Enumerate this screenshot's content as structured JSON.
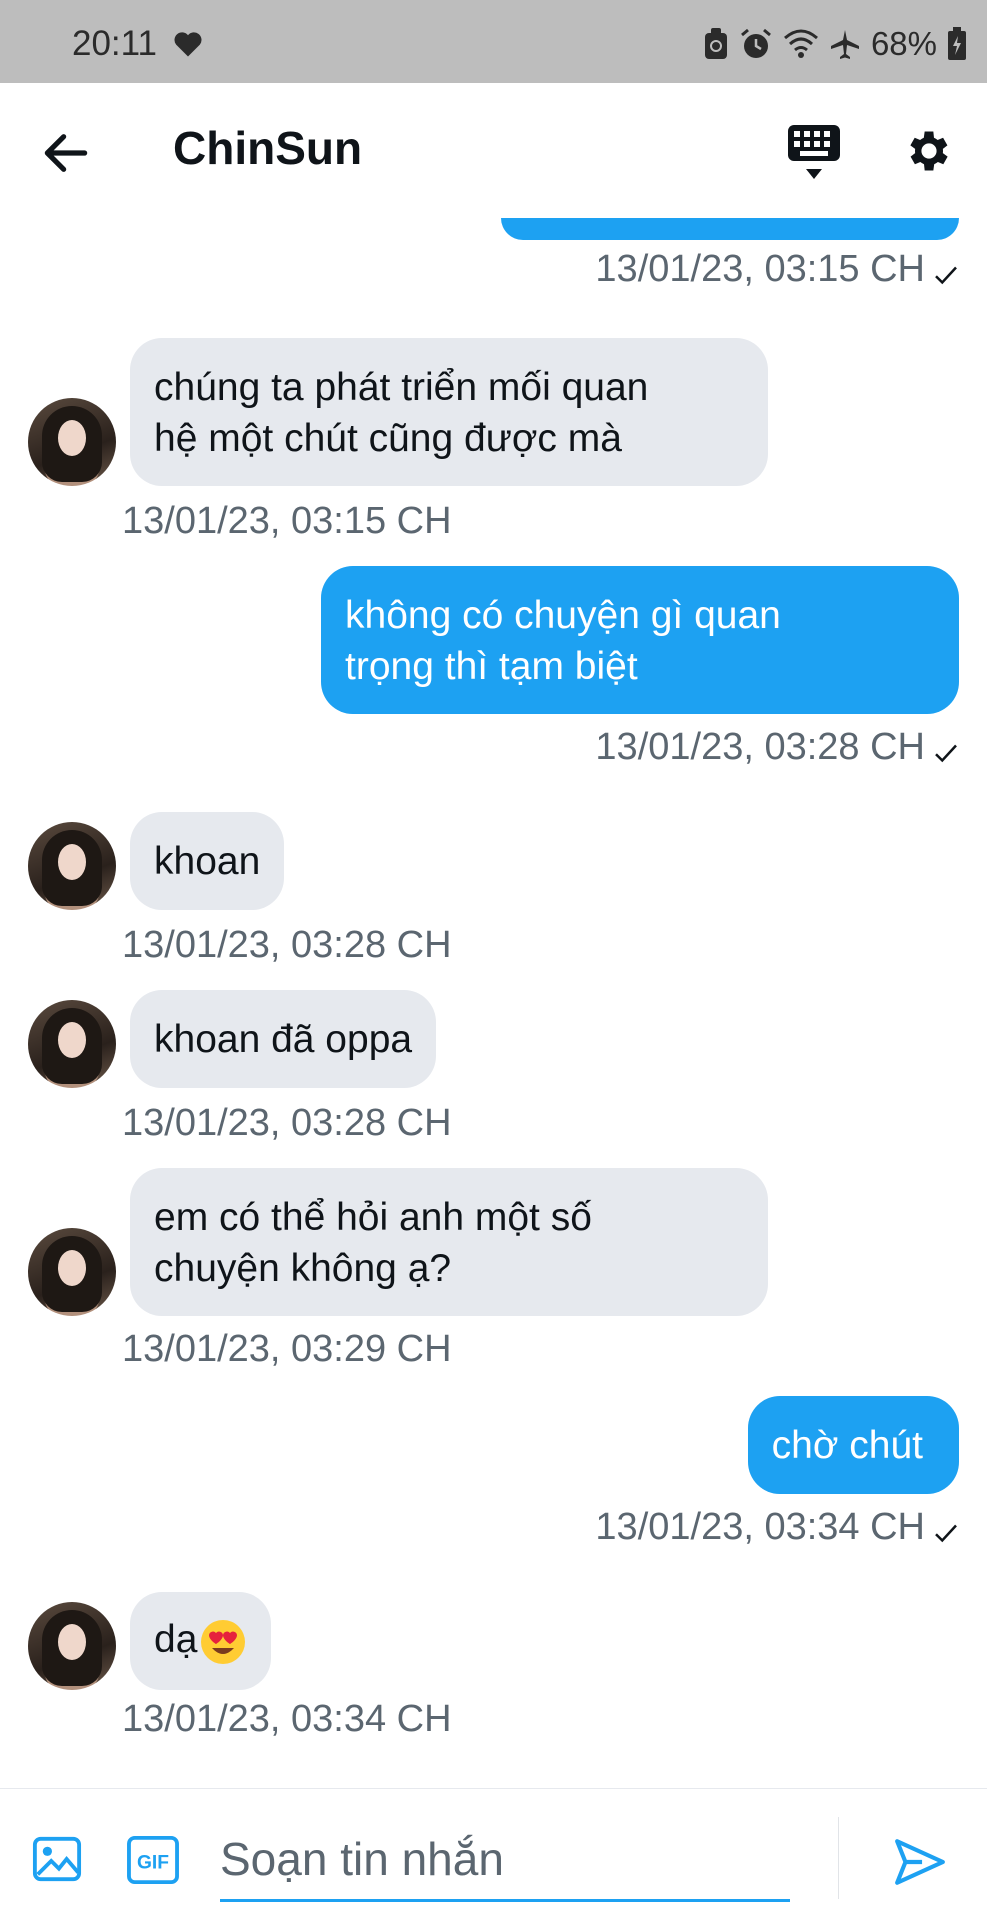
{
  "status_bar": {
    "time": "20:11",
    "battery": "68%"
  },
  "header": {
    "title": "ChinSun"
  },
  "colors": {
    "accent": "#1da1f2",
    "incoming_bubble": "#e6e9ee",
    "timestamp": "#5b6670"
  },
  "messages": [
    {
      "direction": "out",
      "text": "",
      "time": "13/01/23, 03:15 CH",
      "read": true
    },
    {
      "direction": "in",
      "line1": "chúng ta phát triển mối quan",
      "line2": "hệ một chút cũng được mà",
      "time": "13/01/23, 03:15 CH"
    },
    {
      "direction": "out",
      "line1": "không có chuyện gì quan",
      "line2": "trọng thì tạm biệt",
      "time": "13/01/23, 03:28 CH",
      "read": true
    },
    {
      "direction": "in",
      "text": "khoan",
      "time": "13/01/23, 03:28 CH"
    },
    {
      "direction": "in",
      "text": "khoan đã oppa",
      "time": "13/01/23, 03:28 CH"
    },
    {
      "direction": "in",
      "line1": "em có thể hỏi anh một số",
      "line2": "chuyện không ạ?",
      "time": "13/01/23, 03:29 CH"
    },
    {
      "direction": "out",
      "text": "chờ chút",
      "time": "13/01/23, 03:34 CH",
      "read": true
    },
    {
      "direction": "in",
      "text": "dạ",
      "emoji": "heart-eyes",
      "time": "13/01/23, 03:34 CH"
    }
  ],
  "composer": {
    "placeholder": "Soạn tin nhắn",
    "gif_label": "GIF"
  },
  "icons": {
    "back": "arrow-left-icon",
    "keyboard": "keyboard-icon",
    "settings": "gear-icon",
    "image": "image-icon",
    "gif": "gif-icon",
    "send": "send-icon"
  }
}
